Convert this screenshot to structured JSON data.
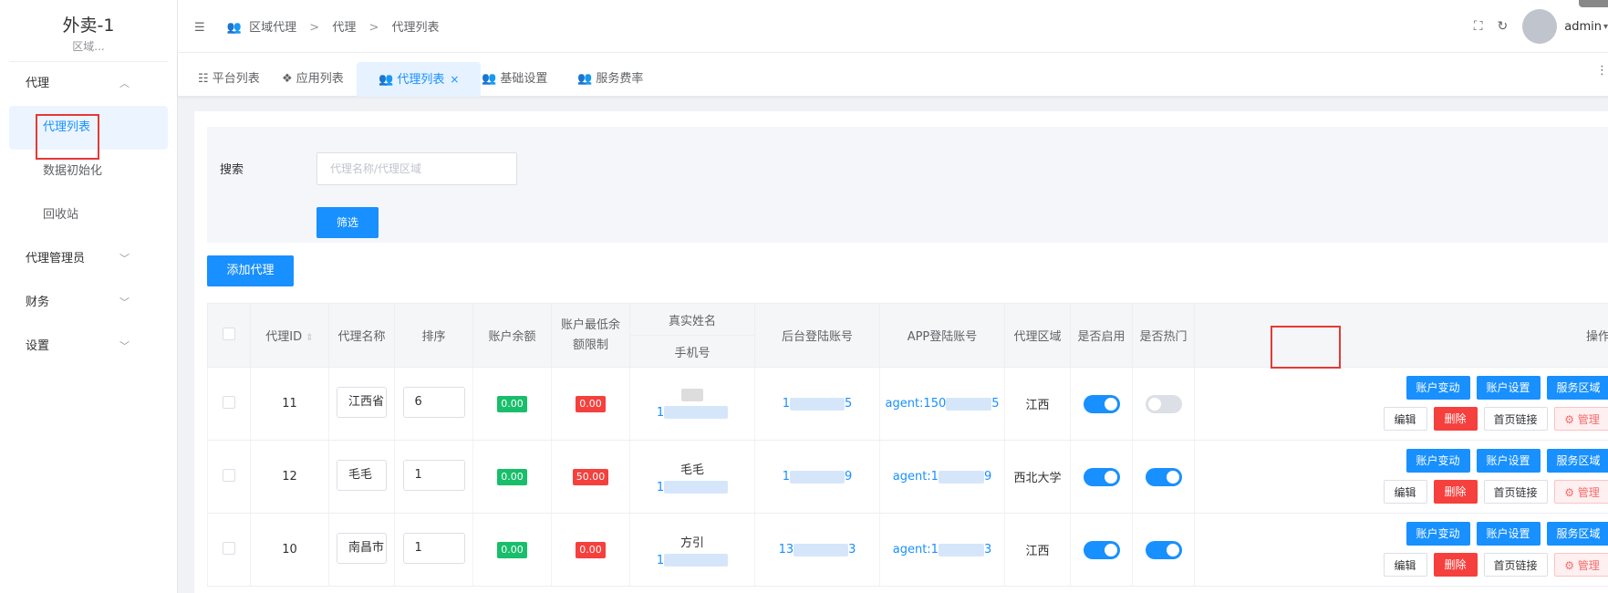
{
  "app": {
    "title": "外卖-1",
    "subtitle": "区域..."
  },
  "sidebar": {
    "groups": [
      {
        "label": "代理",
        "items": [
          {
            "label": "代理列表"
          },
          {
            "label": "数据初始化"
          },
          {
            "label": "回收站"
          }
        ]
      },
      {
        "label": "代理管理员"
      },
      {
        "label": "财务"
      },
      {
        "label": "设置"
      }
    ]
  },
  "breadcrumb": [
    "区域代理",
    "代理",
    "代理列表"
  ],
  "header": {
    "user": "admin"
  },
  "tabs": [
    "平台列表",
    "应用列表",
    "代理列表",
    "基础设置",
    "服务费率"
  ],
  "search": {
    "label": "搜索",
    "placeholder": "代理名称/代理区域",
    "filter_label": "筛选"
  },
  "add_label": "添加代理",
  "table": {
    "headers": {
      "id": "代理ID",
      "name": "代理名称",
      "sort": "排序",
      "balance": "账户余额",
      "min_balance": "账户最低余额限制",
      "real_name": "真实姓名",
      "phone": "手机号",
      "backend_account": "后台登陆账号",
      "app_account": "APP登陆账号",
      "region": "代理区域",
      "enabled": "是否启用",
      "hot": "是否热门",
      "ops": "操作"
    },
    "rows": [
      {
        "id": "11",
        "name": "江西省",
        "sort": "6",
        "balance": "0.00",
        "min_balance": "0.00",
        "real_name": "",
        "phone_prefix": "1",
        "backend_prefix": "1",
        "backend_suffix": "5",
        "app_prefix": "agent:150",
        "app_suffix": "5",
        "region": "江西",
        "enabled": true,
        "hot": false
      },
      {
        "id": "12",
        "name": "毛毛",
        "sort": "1",
        "balance": "0.00",
        "min_balance": "50.00",
        "real_name": "毛毛",
        "phone_prefix": "1",
        "backend_prefix": "1",
        "backend_suffix": "9",
        "app_prefix": "agent:1",
        "app_suffix": "9",
        "region": "西北大学",
        "enabled": true,
        "hot": true
      },
      {
        "id": "10",
        "name": "南昌市",
        "sort": "1",
        "balance": "0.00",
        "min_balance": "0.00",
        "real_name": "方引",
        "phone_prefix": "1",
        "backend_prefix": "13",
        "backend_suffix": "3",
        "app_prefix": "agent:1",
        "app_suffix": "3",
        "region": "江西",
        "enabled": true,
        "hot": true
      }
    ],
    "ops": {
      "account_change": "账户变动",
      "account_settings": "账户设置",
      "service_region": "服务区域",
      "edit": "编辑",
      "delete": "删除",
      "home_link": "首页链接",
      "manage": "管理"
    }
  },
  "colors": {
    "primary": "#1890ff",
    "danger": "#f5403d",
    "success": "#19be6b",
    "highlight": "#e53935"
  }
}
